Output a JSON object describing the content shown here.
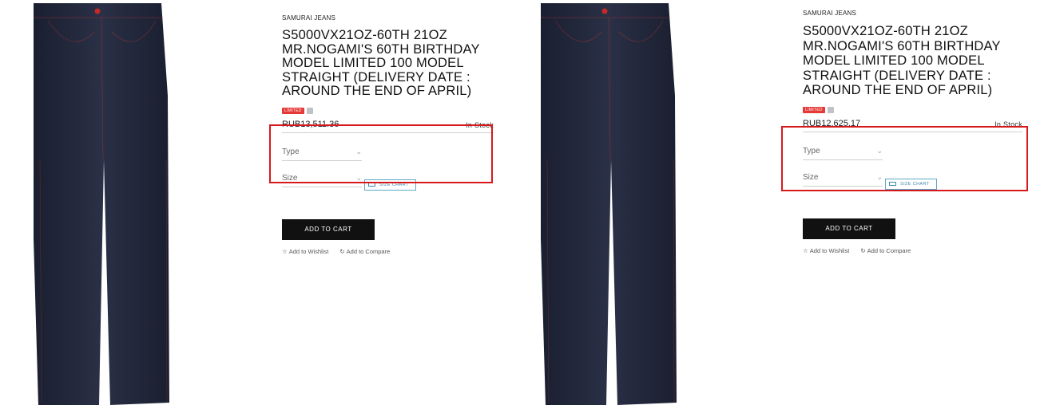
{
  "colors": {
    "highlight": "#d7191c",
    "badge": "#e53935",
    "button": "#111111",
    "size_chart": "#3f86aa",
    "denim": "#22273a"
  },
  "panels": [
    {
      "brand": "SAMURAI JEANS",
      "title": "S5000VX21OZ-60TH 21OZ MR.NOGAMI'S 60TH BIRTHDAY MODEL LIMITED 100 MODEL STRAIGHT (DELIVERY DATE : AROUND THE END OF APRIL)",
      "badge": "LIMITED",
      "price": "RUB13,511.36",
      "stock": "In Stock",
      "type_label": "Type",
      "size_label": "Size",
      "size_chart": "SIZE CHART",
      "add_to_cart": "ADD TO CART",
      "wishlist": "Add to Wishlist",
      "compare": "Add to Compare",
      "icons": {
        "wishlist": "star-icon",
        "compare": "refresh-icon",
        "chevron": "chevron-down-icon",
        "ruler": "ruler-icon"
      }
    },
    {
      "brand": "SAMURAI JEANS",
      "title": "S5000VX21OZ-60TH 21OZ MR.NOGAMI'S 60TH BIRTHDAY MODEL LIMITED 100 MODEL STRAIGHT (DELIVERY DATE : AROUND THE END OF APRIL)",
      "badge": "LIMITED",
      "price": "RUB12,625.17",
      "stock": "In Stock",
      "type_label": "Type",
      "size_label": "Size",
      "size_chart": "SIZE CHART",
      "add_to_cart": "ADD TO CART",
      "wishlist": "Add to Wishlist",
      "compare": "Add to Compare",
      "icons": {
        "wishlist": "star-icon",
        "compare": "refresh-icon",
        "chevron": "chevron-down-icon",
        "ruler": "ruler-icon"
      }
    }
  ]
}
